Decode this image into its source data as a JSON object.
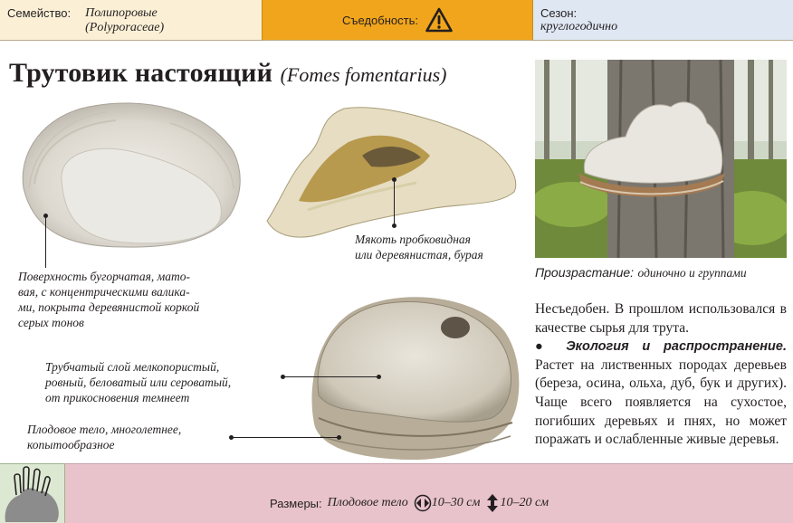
{
  "header": {
    "family_label": "Семейство:",
    "family_ru": "Полипоровые",
    "family_lat": "(Polyporaceae)",
    "edibility_label": "Съедобность:",
    "edibility_icon": "warning-triangle-icon",
    "season_label": "Сезон:",
    "season_value": "круглогодично"
  },
  "title": {
    "name_ru": "Трутовик настоящий",
    "name_lat": "(Fomes fomentarius)"
  },
  "annotations": {
    "surface": [
      "Поверхность бугорчатая, мато-",
      "вая, с концентрическими валика-",
      "ми, покрыта деревянистой коркой",
      "серых тонов"
    ],
    "flesh": [
      "Мякоть пробковидная",
      "или деревянистая, бурая"
    ],
    "tubes": [
      "Трубчатый слой мелкопористый,",
      "ровный, беловатый или сероватый,",
      "от прикосновения темнеет"
    ],
    "fruitbody": [
      "Плодовое тело, многолетнее,",
      "копытообразное"
    ]
  },
  "habitat": {
    "label": "Произрастание:",
    "value": "одиночно и группами"
  },
  "description": {
    "intro": "Несъедобен. В прошлом использовался в качестве сырья для трута.",
    "ecology_title": "● Экология и распространение.",
    "ecology_text": "Растет на лиственных породах деревьев (береза, осина, ольха, дуб, бук и других). Чаще всего появляется на сухостое, погибших деревьях и пнях, но может поражать и ослабленные живые деревья."
  },
  "footer": {
    "corner_icon": "mushroom-group-silhouette-icon",
    "sizes_label": "Размеры:",
    "sizes_body": "Плодовое тело",
    "width_icon": "horizontal-arrows-icon",
    "width_value": "10–30 см",
    "height_icon": "vertical-arrows-icon",
    "height_value": "10–20 см"
  },
  "colors": {
    "family_bg": "#fbf0d6",
    "edibility_bg": "#f1a51c",
    "season_bg": "#dfe7f3",
    "footer_bg": "#e8c3cb",
    "corner_bg": "#dde8d3"
  }
}
